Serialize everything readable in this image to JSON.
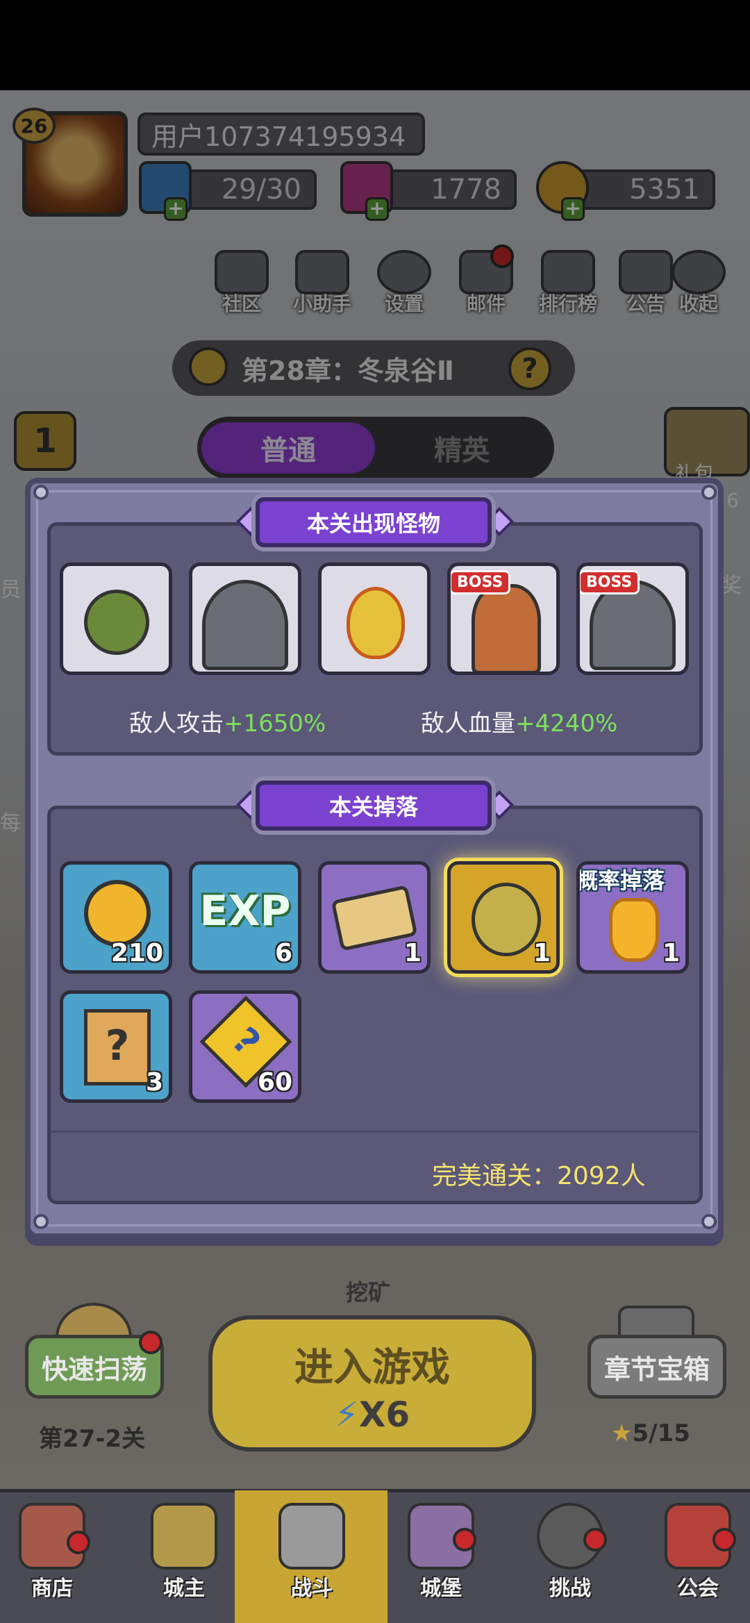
{
  "player": {
    "level": "26",
    "name": "用户107374195934",
    "energy": "29/30",
    "gems": "1778",
    "gold": "5351"
  },
  "top_menu": [
    {
      "label": "社区",
      "icon": "community-icon"
    },
    {
      "label": "小助手",
      "icon": "assistant-icon"
    },
    {
      "label": "设置",
      "icon": "gear-icon"
    },
    {
      "label": "邮件",
      "icon": "mail-icon"
    },
    {
      "label": "排行榜",
      "icon": "leaderboard-icon"
    },
    {
      "label": "公告",
      "icon": "announcement-icon"
    },
    {
      "label": "收起",
      "icon": "collapse-icon"
    }
  ],
  "chapter": {
    "title": "第28章：冬泉谷Ⅱ",
    "help_symbol": "?"
  },
  "left_badge": "1",
  "right_side": {
    "gift_label": "礼包",
    "cut_number": "6",
    "reward_label": "奖"
  },
  "tabs": {
    "normal": "普通",
    "elite": "精英"
  },
  "popup": {
    "monsters_title": "本关出现怪物",
    "monsters": [
      {
        "name": "green-ghost",
        "boss": false
      },
      {
        "name": "armored-knight",
        "boss": false
      },
      {
        "name": "fire-spirit",
        "boss": false
      },
      {
        "name": "elf-archer",
        "boss": true
      },
      {
        "name": "armored-knight-boss",
        "boss": true
      }
    ],
    "boss_tag": "BOSS",
    "enemy_attack_label": "敌人攻击",
    "enemy_attack_value": "+1650%",
    "enemy_hp_label": "敌人血量",
    "enemy_hp_value": "+4240%",
    "drops_title": "本关掉落",
    "drops": [
      {
        "icon": "gold-coin-icon",
        "qty": "210",
        "style": "blue"
      },
      {
        "icon": "exp-icon",
        "qty": "6",
        "style": "blue",
        "text": "EXP"
      },
      {
        "icon": "crown-ticket-icon",
        "qty": "1",
        "style": "purple"
      },
      {
        "icon": "mystery-gem-bag-icon",
        "qty": "1",
        "style": "gold"
      },
      {
        "icon": "fire-crystal-icon",
        "qty": "1",
        "style": "purple",
        "tag": "概率掉落"
      },
      {
        "icon": "mystery-scroll-icon",
        "qty": "3",
        "style": "blue"
      },
      {
        "icon": "puzzle-piece-icon",
        "qty": "60",
        "style": "purple"
      }
    ],
    "perfect_clear": "完美通关：2092人"
  },
  "background_labels": {
    "side_left_1": "员",
    "side_left_2": "每",
    "mining": "挖矿"
  },
  "bottom": {
    "quick_sweep": "快速扫荡",
    "quick_sweep_stage": "第27-2关",
    "enter_game": "进入游戏",
    "enter_cost": "X6",
    "chapter_chest": "章节宝箱",
    "chest_stars": "5/15"
  },
  "nav": [
    {
      "label": "商店",
      "icon": "shop-icon"
    },
    {
      "label": "城主",
      "icon": "crown-icon"
    },
    {
      "label": "战斗",
      "icon": "swords-icon"
    },
    {
      "label": "城堡",
      "icon": "castle-icon"
    },
    {
      "label": "挑战",
      "icon": "challenge-icon"
    },
    {
      "label": "公会",
      "icon": "guild-icon"
    }
  ]
}
